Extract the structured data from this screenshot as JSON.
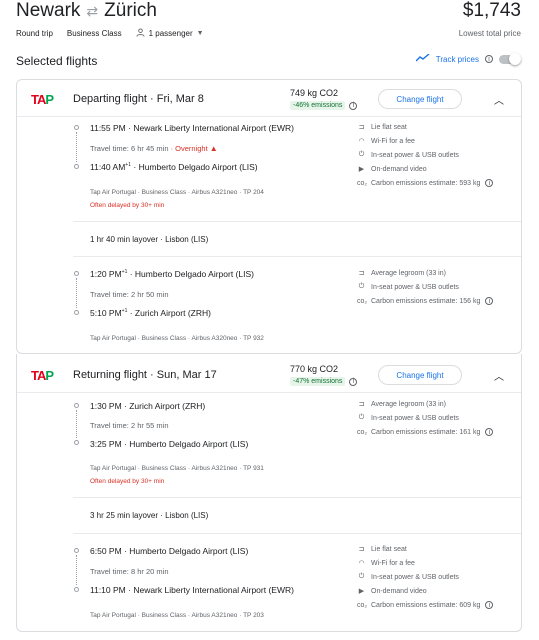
{
  "header": {
    "origin": "Newark",
    "destination": "Zürich",
    "price": "$1,743",
    "price_note": "Lowest total price",
    "trip_type": "Round trip",
    "cabin": "Business Class",
    "passengers": "1 passenger"
  },
  "selected_title": "Selected flights",
  "track_label": "Track prices",
  "departing": {
    "airline_logo": "TAP",
    "title": "Departing flight · Fri, Mar 8",
    "co2": "749 kg CO2",
    "emissions_badge": "-46% emissions",
    "change_label": "Change flight",
    "seg1": {
      "dep_time": "11:55 PM",
      "dep_airport": "Newark Liberty International Airport (EWR)",
      "travel_time": "Travel time: 6 hr 45 min",
      "overnight": "Overnight",
      "arr_time": "11:40 AM",
      "arr_sup": "+1",
      "arr_airport": "Humberto Delgado Airport (LIS)",
      "details": "Tap Air Portugal · Business Class · Airbus A321neo · TP 204",
      "delay": "Often delayed by 30+ min",
      "amenities": [
        {
          "icon": "seat-icon",
          "glyph": "⊐",
          "label": "Lie flat seat"
        },
        {
          "icon": "wifi-icon",
          "glyph": "◠",
          "label": "Wi-Fi for a fee"
        },
        {
          "icon": "power-icon",
          "glyph": "⏻",
          "label": "In-seat power & USB outlets"
        },
        {
          "icon": "video-icon",
          "glyph": "▶",
          "label": "On-demand video"
        },
        {
          "icon": "co2-icon",
          "glyph": "co₂",
          "label": "Carbon emissions estimate: 593 kg"
        }
      ]
    },
    "layover": "1 hr 40 min layover · Lisbon (LIS)",
    "seg2": {
      "dep_time": "1:20 PM",
      "dep_sup": "+1",
      "dep_airport": "Humberto Delgado Airport (LIS)",
      "travel_time": "Travel time: 2 hr 50 min",
      "arr_time": "5:10 PM",
      "arr_sup": "+1",
      "arr_airport": "Zurich Airport (ZRH)",
      "details": "Tap Air Portugal · Business Class · Airbus A320neo · TP 932",
      "amenities": [
        {
          "icon": "legroom-icon",
          "glyph": "⊐",
          "label": "Average legroom (33 in)"
        },
        {
          "icon": "power-icon",
          "glyph": "⏻",
          "label": "In-seat power & USB outlets"
        },
        {
          "icon": "co2-icon",
          "glyph": "co₂",
          "label": "Carbon emissions estimate: 156 kg"
        }
      ]
    }
  },
  "returning": {
    "airline_logo": "TAP",
    "title": "Returning flight · Sun, Mar 17",
    "co2": "770 kg CO2",
    "emissions_badge": "-47% emissions",
    "change_label": "Change flight",
    "seg1": {
      "dep_time": "1:30 PM",
      "dep_airport": "Zurich Airport (ZRH)",
      "travel_time": "Travel time: 2 hr 55 min",
      "arr_time": "3:25 PM",
      "arr_airport": "Humberto Delgado Airport (LIS)",
      "details": "Tap Air Portugal · Business Class · Airbus A321neo · TP 931",
      "delay": "Often delayed by 30+ min",
      "amenities": [
        {
          "icon": "legroom-icon",
          "glyph": "⊐",
          "label": "Average legroom (33 in)"
        },
        {
          "icon": "power-icon",
          "glyph": "⏻",
          "label": "In-seat power & USB outlets"
        },
        {
          "icon": "co2-icon",
          "glyph": "co₂",
          "label": "Carbon emissions estimate: 161 kg"
        }
      ]
    },
    "layover": "3 hr 25 min layover · Lisbon (LIS)",
    "seg2": {
      "dep_time": "6:50 PM",
      "dep_airport": "Humberto Delgado Airport (LIS)",
      "travel_time": "Travel time: 8 hr 20 min",
      "arr_time": "11:10 PM",
      "arr_airport": "Newark Liberty International Airport (EWR)",
      "details": "Tap Air Portugal · Business Class · Airbus A321neo · TP 203",
      "amenities": [
        {
          "icon": "seat-icon",
          "glyph": "⊐",
          "label": "Lie flat seat"
        },
        {
          "icon": "wifi-icon",
          "glyph": "◠",
          "label": "Wi-Fi for a fee"
        },
        {
          "icon": "power-icon",
          "glyph": "⏻",
          "label": "In-seat power & USB outlets"
        },
        {
          "icon": "video-icon",
          "glyph": "▶",
          "label": "On-demand video"
        },
        {
          "icon": "co2-icon",
          "glyph": "co₂",
          "label": "Carbon emissions estimate: 609 kg"
        }
      ]
    }
  },
  "colors": {
    "accent": "#1a73e8",
    "warning": "#d93025",
    "tap_red": "#e2001a",
    "tap_green": "#00a651",
    "emissions_green": "#137333"
  }
}
